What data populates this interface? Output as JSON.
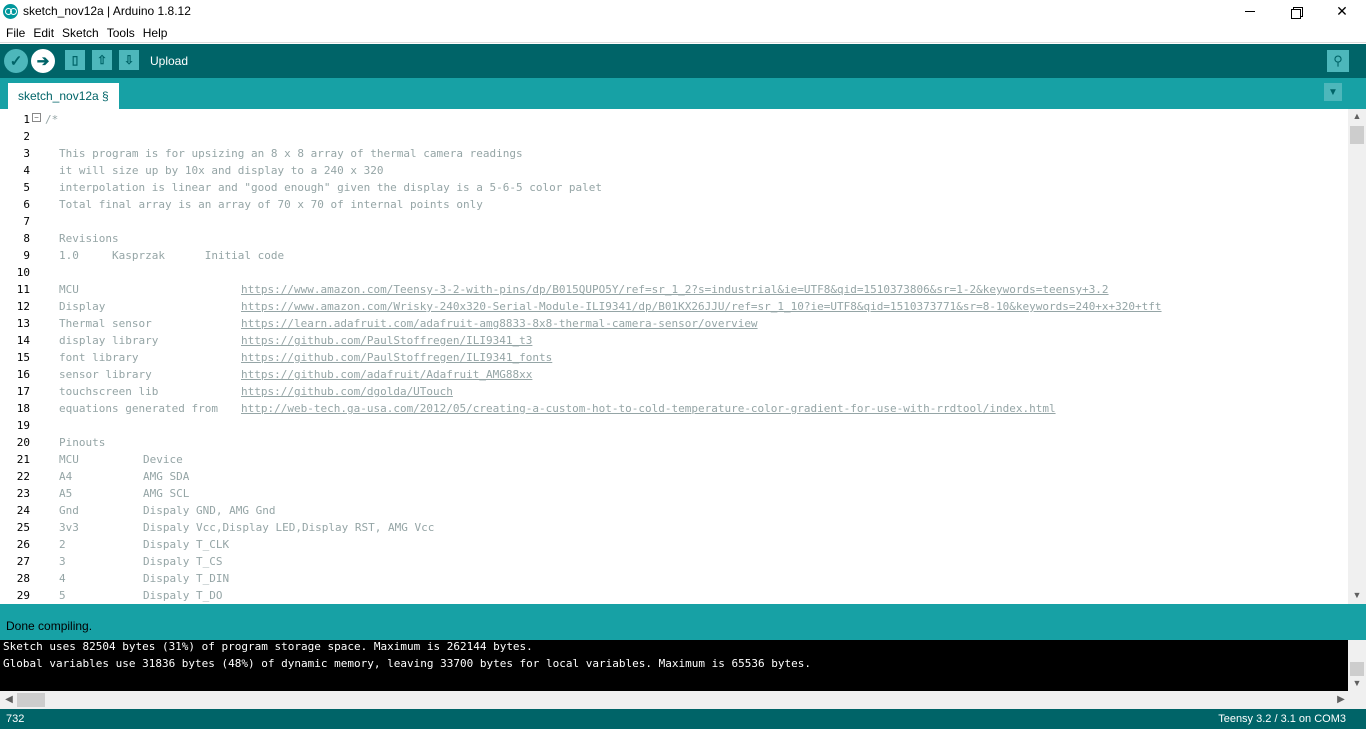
{
  "window": {
    "title": "sketch_nov12a | Arduino 1.8.12",
    "controls": {
      "minimize": "",
      "maximize": "",
      "close": "✕"
    }
  },
  "menu": [
    "File",
    "Edit",
    "Sketch",
    "Tools",
    "Help"
  ],
  "toolbar": {
    "hover_label": "Upload",
    "buttons": [
      {
        "name": "verify",
        "icon": "✓"
      },
      {
        "name": "upload",
        "icon": "➔"
      },
      {
        "name": "new",
        "icon": "▯"
      },
      {
        "name": "open",
        "icon": "⇧"
      },
      {
        "name": "save",
        "icon": "⇩"
      }
    ],
    "serial_monitor_icon": "⚲"
  },
  "tabs": [
    {
      "label": "sketch_nov12a §"
    }
  ],
  "tab_menu_icon": "▼",
  "editor": {
    "lines": [
      {
        "n": "1",
        "text": "/*"
      },
      {
        "n": "2",
        "text": ""
      },
      {
        "n": "3",
        "text": "This program is for upsizing an 8 x 8 array of thermal camera readings"
      },
      {
        "n": "4",
        "text": "it will size up by 10x and display to a 240 x 320"
      },
      {
        "n": "5",
        "text": "interpolation is linear and \"good enough\" given the display is a 5-6-5 color palet"
      },
      {
        "n": "6",
        "text": "Total final array is an array of 70 x 70 of internal points only"
      },
      {
        "n": "7",
        "text": ""
      },
      {
        "n": "8",
        "text": "Revisions"
      },
      {
        "n": "9",
        "text": "1.0     Kasprzak      Initial code"
      },
      {
        "n": "10",
        "text": ""
      },
      {
        "n": "11",
        "label": "MCU",
        "url": "https://www.amazon.com/Teensy-3-2-with-pins/dp/B015QUPO5Y/ref=sr_1_2?s=industrial&ie=UTF8&qid=1510373806&sr=1-2&keywords=teensy+3.2"
      },
      {
        "n": "12",
        "label": "Display",
        "url": "https://www.amazon.com/Wrisky-240x320-Serial-Module-ILI9341/dp/B01KX26JJU/ref=sr_1_10?ie=UTF8&qid=1510373771&sr=8-10&keywords=240+x+320+tft"
      },
      {
        "n": "13",
        "label": "Thermal sensor",
        "url": "https://learn.adafruit.com/adafruit-amg8833-8x8-thermal-camera-sensor/overview"
      },
      {
        "n": "14",
        "label": "display library",
        "url": "https://github.com/PaulStoffregen/ILI9341_t3"
      },
      {
        "n": "15",
        "label": "font library",
        "url": "https://github.com/PaulStoffregen/ILI9341_fonts"
      },
      {
        "n": "16",
        "label": "sensor library",
        "url": "https://github.com/adafruit/Adafruit_AMG88xx"
      },
      {
        "n": "17",
        "label": "touchscreen lib",
        "url": "https://github.com/dgolda/UTouch"
      },
      {
        "n": "18",
        "label": "equations generated from",
        "url": "http://web-tech.ga-usa.com/2012/05/creating-a-custom-hot-to-cold-temperature-color-gradient-for-use-with-rrdtool/index.html"
      },
      {
        "n": "19",
        "text": ""
      },
      {
        "n": "20",
        "text": "Pinouts"
      },
      {
        "n": "21",
        "col1": "MCU",
        "col2": "Device"
      },
      {
        "n": "22",
        "col1": "A4",
        "col2": "AMG SDA"
      },
      {
        "n": "23",
        "col1": "A5",
        "col2": "AMG SCL"
      },
      {
        "n": "24",
        "col1": "Gnd",
        "col2": "Dispaly GND, AMG Gnd"
      },
      {
        "n": "25",
        "col1": "3v3",
        "col2": "Dispaly Vcc,Display LED,Display RST, AMG Vcc"
      },
      {
        "n": "26",
        "col1": "2",
        "col2": "Dispaly T_CLK"
      },
      {
        "n": "27",
        "col1": "3",
        "col2": "Dispaly T_CS"
      },
      {
        "n": "28",
        "col1": "4",
        "col2": "Dispaly T_DIN"
      },
      {
        "n": "29",
        "col1": "5",
        "col2": "Dispaly T_DO"
      }
    ],
    "fold_icon": "−"
  },
  "status": {
    "message": "Done compiling."
  },
  "console": {
    "lines": [
      "Sketch uses 82504 bytes (31%) of program storage space. Maximum is 262144 bytes.",
      "Global variables use 31836 bytes (48%) of dynamic memory, leaving 33700 bytes for local variables. Maximum is 65536 bytes."
    ]
  },
  "bottom": {
    "line_number": "732",
    "board": "Teensy 3.2 / 3.1 on COM3"
  },
  "scroll_arrows": {
    "up": "▲",
    "down": "▼",
    "left": "◀",
    "right": "▶"
  }
}
